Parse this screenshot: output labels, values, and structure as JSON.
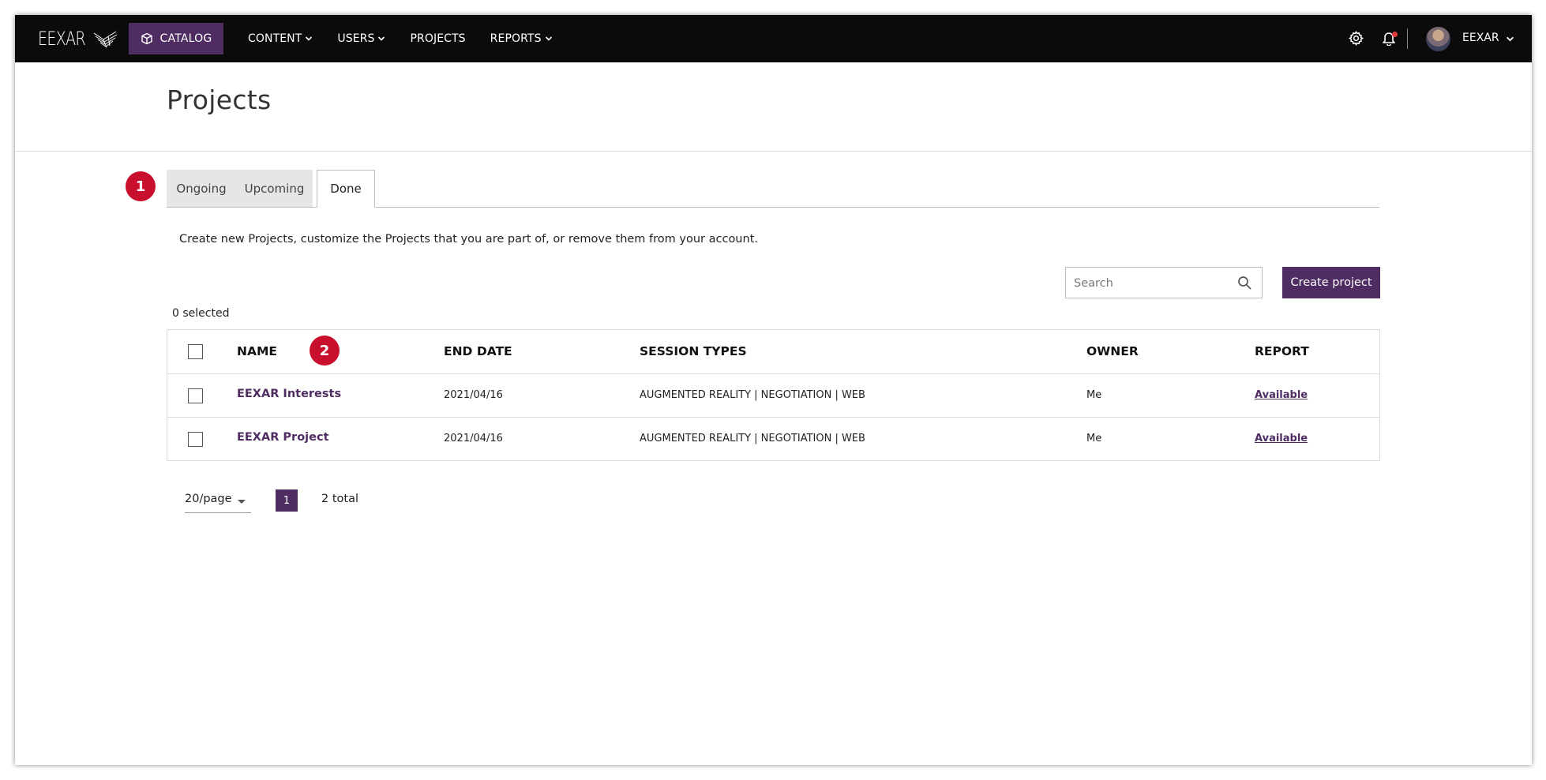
{
  "app": {
    "logo_text": "EEXAR",
    "nav": {
      "catalog": "CATALOG",
      "items": [
        {
          "label": "CONTENT",
          "has_dropdown": true
        },
        {
          "label": "USERS",
          "has_dropdown": true
        },
        {
          "label": "PROJECTS",
          "has_dropdown": false
        },
        {
          "label": "REPORTS",
          "has_dropdown": true
        }
      ]
    },
    "user": {
      "name": "EEXAR"
    },
    "icons": [
      "settings-icon",
      "bell-icon",
      "avatar",
      "chevron-down-icon",
      "cube-icon"
    ],
    "colors": {
      "brand": "#4f2d62",
      "topbar": "#0b0b0b",
      "badge": "#c8102e",
      "notification_dot": "#e23b3b"
    }
  },
  "page": {
    "title": "Projects",
    "tabs": [
      {
        "label": "Ongoing",
        "active": false
      },
      {
        "label": "Upcoming",
        "active": false
      },
      {
        "label": "Done",
        "active": true
      }
    ],
    "description": "Create new Projects, customize the Projects that you are part of, or remove them from your account.",
    "search": {
      "placeholder": "Search"
    },
    "create_button": "Create project",
    "selected_count": "0 selected",
    "annotations": [
      "1",
      "2"
    ]
  },
  "table": {
    "columns": [
      "NAME",
      "END DATE",
      "SESSION TYPES",
      "OWNER",
      "REPORT"
    ],
    "rows": [
      {
        "name": "EEXAR Interests",
        "end_date": "2021/04/16",
        "session_types": "AUGMENTED REALITY | NEGOTIATION | WEB",
        "owner": "Me",
        "report": "Available"
      },
      {
        "name": "EEXAR Project",
        "end_date": "2021/04/16",
        "session_types": "AUGMENTED REALITY | NEGOTIATION | WEB",
        "owner": "Me",
        "report": "Available"
      }
    ]
  },
  "pagination": {
    "page_size": "20/page",
    "current_page": "1",
    "total": "2 total"
  }
}
